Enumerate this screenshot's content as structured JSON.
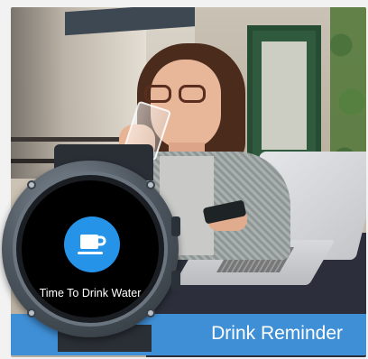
{
  "watch": {
    "notification_text": "Time To Drink Water",
    "icon": "coffee-cup-icon",
    "icon_background": "#2593e8"
  },
  "banner": {
    "label": "Drink Reminder",
    "background": "#3f8fd6"
  }
}
